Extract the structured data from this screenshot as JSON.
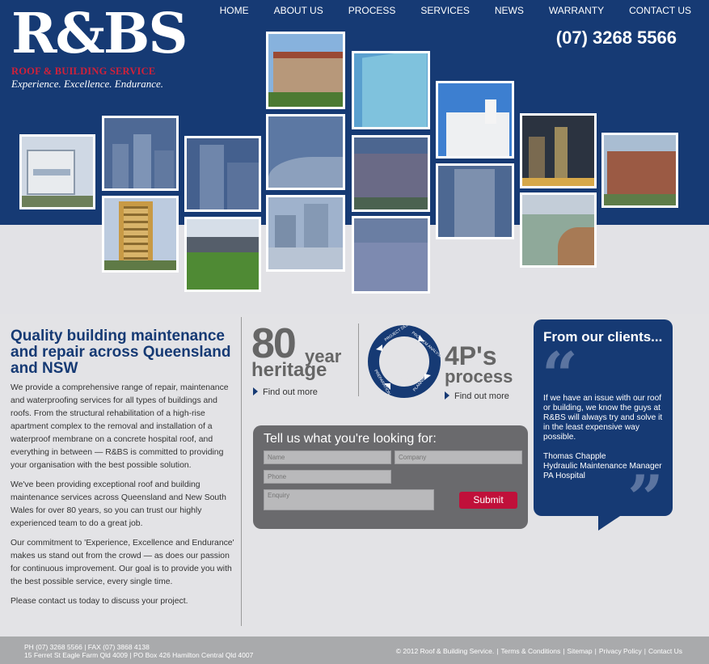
{
  "header": {
    "logo_main": "R&BS",
    "logo_sub": "ROOF & BUILDING SERVICE",
    "logo_tag": "Experience. Excellence. Endurance.",
    "phone": "(07) 3268 5566",
    "nav": [
      "HOME",
      "ABOUT US",
      "PROCESS",
      "SERVICES",
      "NEWS",
      "WARRANTY",
      "CONTACT US"
    ]
  },
  "intro": {
    "title": "Quality building maintenance and repair across Queensland and NSW",
    "paragraphs": [
      "We provide a comprehensive range of repair, maintenance and waterproofing services for all types of buildings and roofs. From the structural rehabilitation of a high-rise apartment complex to the removal and installation of a waterproof membrane on a concrete hospital roof, and everything in between — R&BS is committed to providing your organisation with the best possible solution.",
      "We've been providing exceptional roof and building maintenance services across Queensland and New South Wales for over 80 years, so you can trust our highly experienced team to do a great job.",
      "Our commitment to 'Experience, Excellence and Endurance' makes us stand out from the crowd — as does our passion for continuous improvement. Our goal is to provide you with the best possible service, every single time.",
      "Please contact us today to discuss your project."
    ]
  },
  "heritage": {
    "number": "80",
    "unit": "year",
    "label": "heritage",
    "link": "Find out more"
  },
  "process": {
    "number": "4P's",
    "label": "process",
    "link": "Find out more",
    "cycle_labels": [
      "PROJECT DELIVERY",
      "PROBLEM ANALYSIS",
      "PLANNING",
      "PREPARATION"
    ]
  },
  "form": {
    "title": "Tell us what you're looking for:",
    "name_placeholder": "Name",
    "company_placeholder": "Company",
    "phone_placeholder": "Phone",
    "enquiry_placeholder": "Enquiry",
    "submit": "Submit"
  },
  "testimonial": {
    "heading": "From our clients...",
    "open_quote": "“",
    "close_quote": "”",
    "text": "If we have an issue with our roof or building, we know the guys at R&BS will always try and solve it in the least expensive way possible.",
    "author_name": "Thomas Chapple",
    "author_role": "Hydraulic Maintenance Manager",
    "author_org": "PA Hospital"
  },
  "footer": {
    "line1": "PH (07) 3268 5566 | FAX (07) 3868 4138",
    "line2": "15 Ferret St Eagle Farm Qld 4009 | PO Box 426 Hamilton Central Qld 4007",
    "copyright": "© 2012 Roof & Building Service.",
    "links": [
      "Terms & Conditions",
      "Sitemap",
      "Privacy Policy",
      "Contact Us"
    ]
  },
  "colors": {
    "navy": "#163a74",
    "red": "#c0103a",
    "gray_form": "#6a6a6d",
    "footer": "#a9aaac"
  }
}
